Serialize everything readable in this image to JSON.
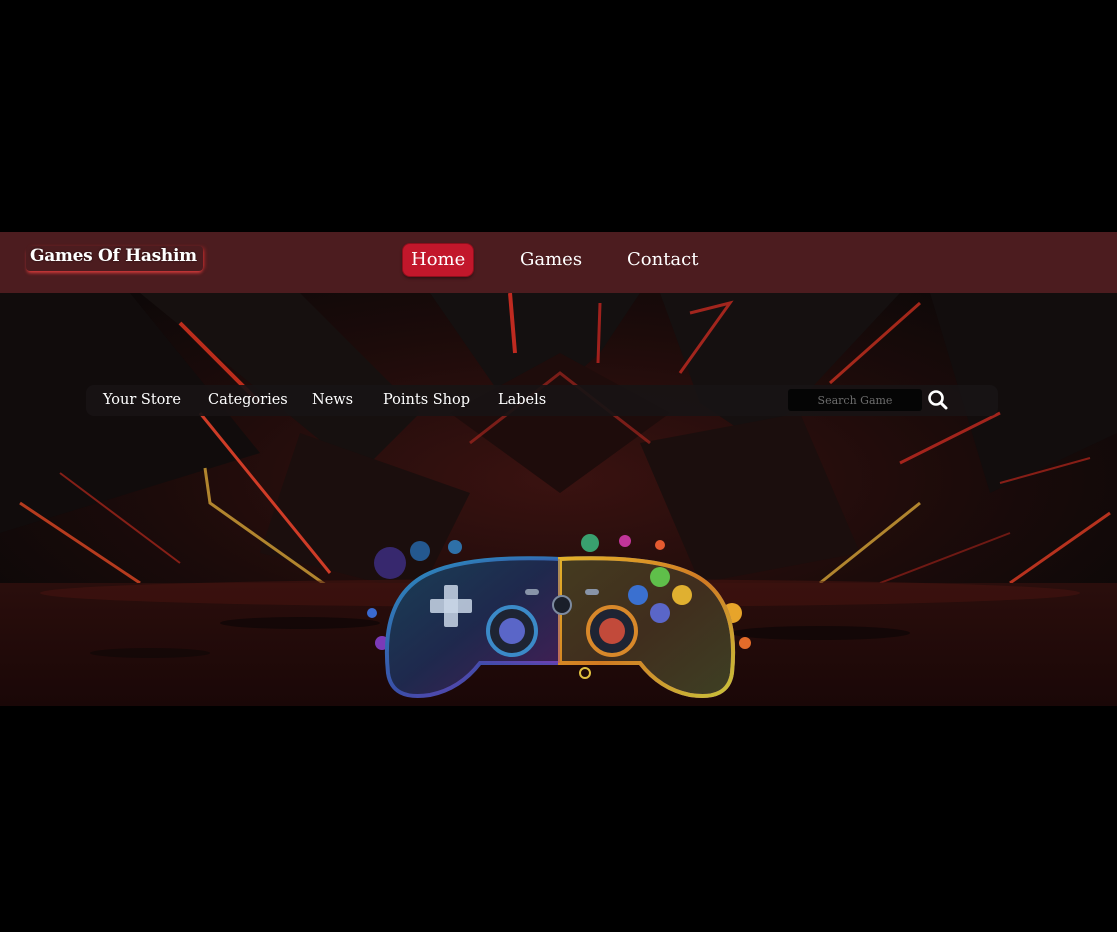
{
  "header": {
    "brand": "Games Of Hashim",
    "nav": [
      {
        "label": "Home",
        "active": true
      },
      {
        "label": "Games",
        "active": false
      },
      {
        "label": "Contact",
        "active": false
      }
    ]
  },
  "subnav": {
    "links": [
      "Your Store",
      "Categories",
      "News",
      "Points Shop",
      "Labels"
    ],
    "search": {
      "placeholder": "Search Game",
      "value": "",
      "icon": "search-icon"
    }
  },
  "hero": {
    "background": "dark red neon gaming backdrop",
    "image": "gamepad-controller-icon"
  },
  "colors": {
    "page_bg": "#000000",
    "header_bg": "#4c1c1f",
    "active_nav": "#c2172b",
    "subnav_bg": "#181415",
    "text": "#ffffff"
  }
}
